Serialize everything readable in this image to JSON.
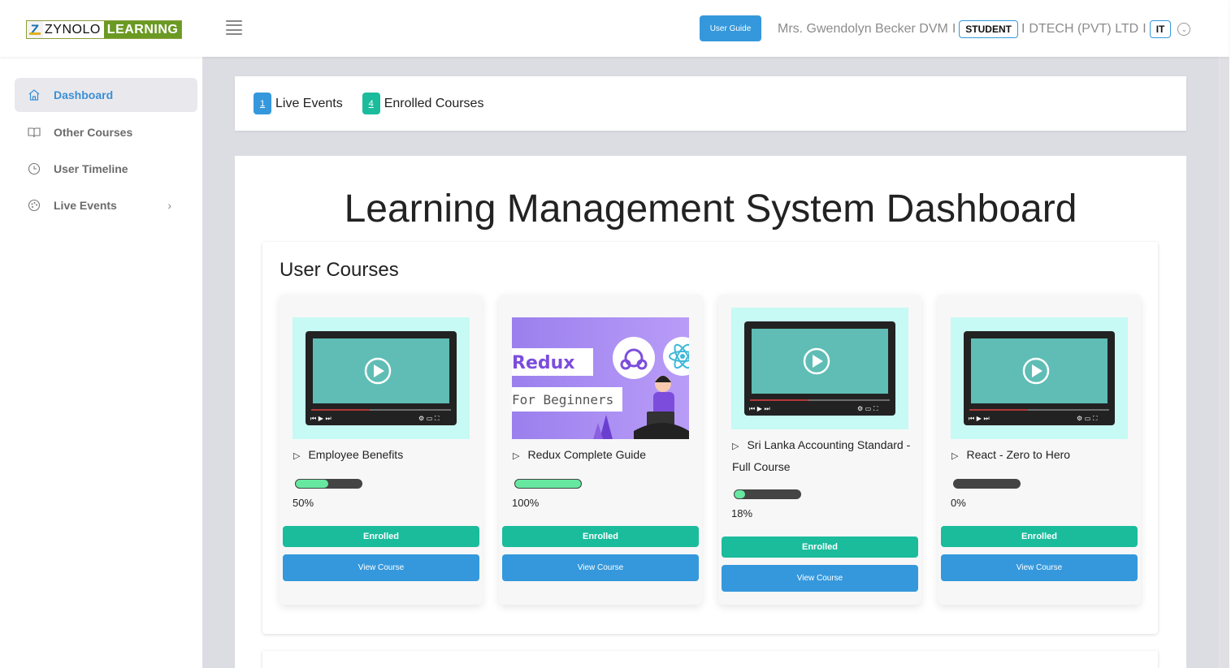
{
  "header": {
    "logo_letter": "Z",
    "logo_word1": "ZYNOLO",
    "logo_word2": "LEARNING",
    "user_guide_label": "User Guide",
    "user_name": "Mrs. Gwendolyn Becker DVM",
    "separator": "I",
    "role": "STUDENT",
    "company": "DTECH (PVT) LTD",
    "department": "IT"
  },
  "sidebar": {
    "items": [
      {
        "label": "Dashboard",
        "icon": "home-icon",
        "active": true
      },
      {
        "label": "Other Courses",
        "icon": "book-icon"
      },
      {
        "label": "User Timeline",
        "icon": "clock-icon"
      },
      {
        "label": "Live Events",
        "icon": "palette-icon",
        "has_submenu": true
      }
    ]
  },
  "stats": {
    "live_events": {
      "count": "1",
      "label": "Live Events",
      "color": "#3598dc"
    },
    "enrolled_courses": {
      "count": "4",
      "label": "Enrolled Courses",
      "color": "#1abc9c"
    }
  },
  "main": {
    "title": "Learning Management System Dashboard",
    "section_title": "User Courses"
  },
  "courses": [
    {
      "title": "Employee Benefits",
      "progress": 50,
      "progress_label": "50%",
      "status": "Enrolled",
      "action": "View Course",
      "thumbnail": "video-player"
    },
    {
      "title": "Redux Complete Guide",
      "progress": 100,
      "progress_label": "100%",
      "status": "Enrolled",
      "action": "View Course",
      "thumbnail": "redux-banner",
      "banner_line1": "Redux",
      "banner_line2": "For Beginners"
    },
    {
      "title": "Sri Lanka Accounting Standard - Full Course",
      "progress": 18,
      "progress_label": "18%",
      "status": "Enrolled",
      "action": "View Course",
      "thumbnail": "video-player"
    },
    {
      "title": "React - Zero to Hero",
      "progress": 0,
      "progress_label": "0%",
      "status": "Enrolled",
      "action": "View Course",
      "thumbnail": "video-player"
    }
  ],
  "colors": {
    "primary": "#3598dc",
    "success": "#1abc9c",
    "progress_fill": "#67e8a1",
    "progress_track": "#444444"
  }
}
